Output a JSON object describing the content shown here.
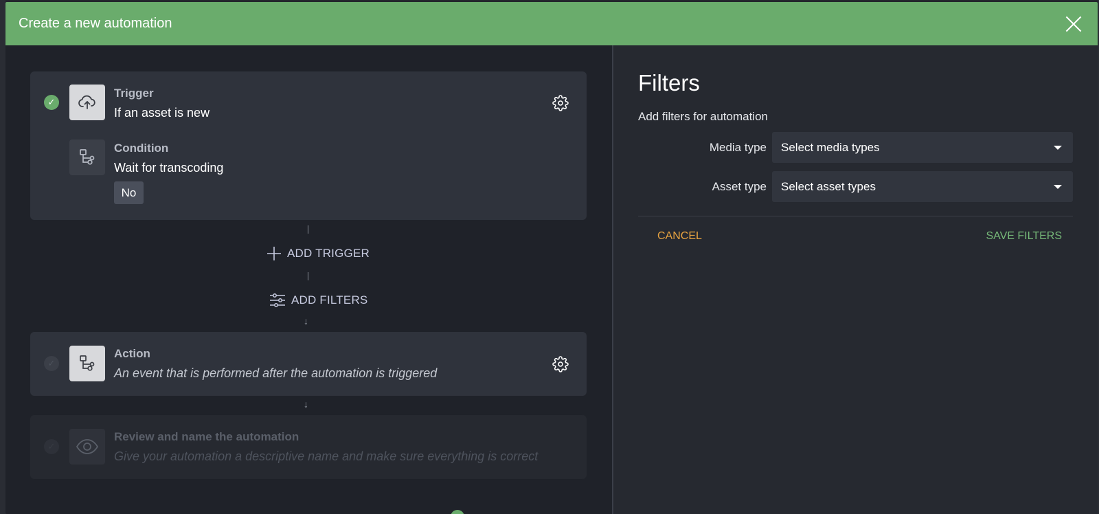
{
  "modal": {
    "title": "Create a new automation"
  },
  "steps": {
    "trigger": {
      "heading": "Trigger",
      "text": "If an asset is new",
      "icon": "cloud-upload-icon"
    },
    "condition": {
      "heading": "Condition",
      "text": "Wait for transcoding",
      "chip": "No",
      "icon": "flow-icon"
    },
    "add_trigger": "ADD TRIGGER",
    "add_filters": "ADD FILTERS",
    "action": {
      "heading": "Action",
      "text": "An event that is performed after the automation is triggered",
      "icon": "flow-icon"
    },
    "review": {
      "heading": "Review and name the automation",
      "text": "Give your automation a descriptive name and make sure everything is correct",
      "icon": "eye-icon"
    }
  },
  "filters": {
    "title": "Filters",
    "subtitle": "Add filters for automation",
    "fields": [
      {
        "label": "Media type",
        "value": "Select media types"
      },
      {
        "label": "Asset type",
        "value": "Select asset types"
      }
    ],
    "cancel": "CANCEL",
    "save": "SAVE FILTERS"
  },
  "colors": {
    "header": "#6aac6c",
    "cancel": "#e7a340",
    "save": "#76b878"
  }
}
